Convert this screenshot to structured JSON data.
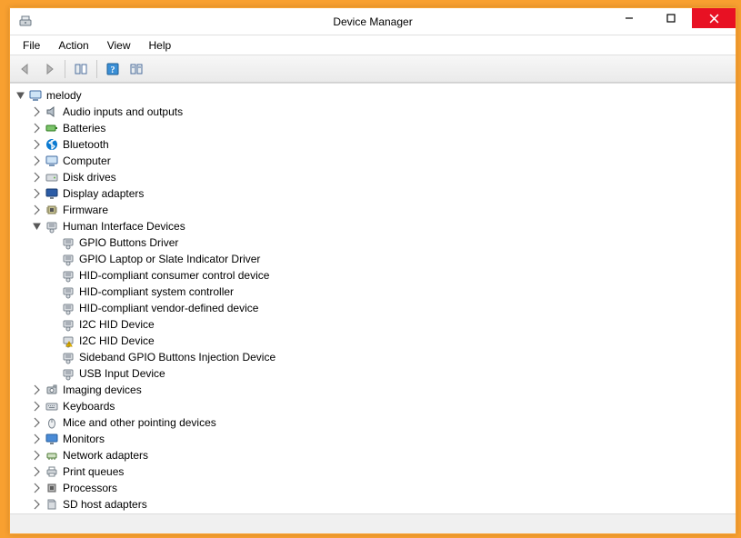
{
  "window": {
    "title": "Device Manager"
  },
  "menu": {
    "file": "File",
    "action": "Action",
    "view": "View",
    "help": "Help"
  },
  "tree": {
    "root": {
      "label": "melody",
      "expanded": true
    },
    "categories": [
      {
        "label": "Audio inputs and outputs",
        "icon": "speaker",
        "expanded": false
      },
      {
        "label": "Batteries",
        "icon": "battery",
        "expanded": false
      },
      {
        "label": "Bluetooth",
        "icon": "bluetooth",
        "expanded": false
      },
      {
        "label": "Computer",
        "icon": "computer",
        "expanded": false
      },
      {
        "label": "Disk drives",
        "icon": "disk",
        "expanded": false
      },
      {
        "label": "Display adapters",
        "icon": "display",
        "expanded": false
      },
      {
        "label": "Firmware",
        "icon": "chip",
        "expanded": false
      },
      {
        "label": "Human Interface Devices",
        "icon": "hid",
        "expanded": true,
        "children": [
          {
            "label": "GPIO Buttons Driver",
            "icon": "hid"
          },
          {
            "label": "GPIO Laptop or Slate Indicator Driver",
            "icon": "hid"
          },
          {
            "label": "HID-compliant consumer control device",
            "icon": "hid"
          },
          {
            "label": "HID-compliant system controller",
            "icon": "hid"
          },
          {
            "label": "HID-compliant vendor-defined device",
            "icon": "hid"
          },
          {
            "label": "I2C HID Device",
            "icon": "hid"
          },
          {
            "label": "I2C HID Device",
            "icon": "hid-warn"
          },
          {
            "label": "Sideband GPIO Buttons Injection Device",
            "icon": "hid"
          },
          {
            "label": "USB Input Device",
            "icon": "hid"
          }
        ]
      },
      {
        "label": "Imaging devices",
        "icon": "camera",
        "expanded": false
      },
      {
        "label": "Keyboards",
        "icon": "keyboard",
        "expanded": false
      },
      {
        "label": "Mice and other pointing devices",
        "icon": "mouse",
        "expanded": false
      },
      {
        "label": "Monitors",
        "icon": "monitor",
        "expanded": false
      },
      {
        "label": "Network adapters",
        "icon": "network",
        "expanded": false
      },
      {
        "label": "Print queues",
        "icon": "printer",
        "expanded": false
      },
      {
        "label": "Processors",
        "icon": "cpu",
        "expanded": false
      },
      {
        "label": "SD host adapters",
        "icon": "sd",
        "expanded": false
      }
    ]
  }
}
